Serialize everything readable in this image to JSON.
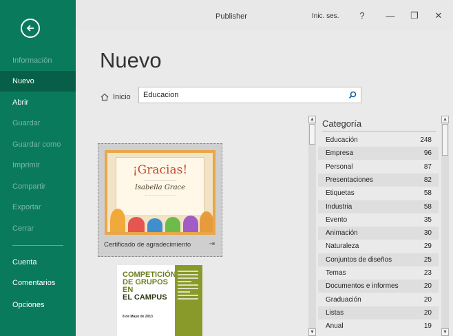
{
  "window": {
    "app_title": "Publisher",
    "signin_label": "Inic. ses.",
    "help_label": "?",
    "minimize_label": "—",
    "restore_label": "❐",
    "close_label": "✕"
  },
  "sidebar": {
    "accent_color": "#0a7a5d",
    "items": [
      {
        "label": "Información",
        "state": "disabled"
      },
      {
        "label": "Nuevo",
        "state": "active"
      },
      {
        "label": "Abrir",
        "state": "normal"
      },
      {
        "label": "Guardar",
        "state": "disabled"
      },
      {
        "label": "Guardar como",
        "state": "disabled"
      },
      {
        "label": "Imprimir",
        "state": "disabled"
      },
      {
        "label": "Compartir",
        "state": "disabled"
      },
      {
        "label": "Exportar",
        "state": "disabled"
      },
      {
        "label": "Cerrar",
        "state": "disabled"
      },
      {
        "label": "Cuenta",
        "state": "normal"
      },
      {
        "label": "Comentarios",
        "state": "normal"
      },
      {
        "label": "Opciones",
        "state": "normal"
      }
    ]
  },
  "main": {
    "page_title": "Nuevo",
    "home_label": "Inicio",
    "search_value": "Educacion",
    "templates": [
      {
        "label": "Certificado de agradecimiento",
        "preview_heading": "¡Gracias!",
        "preview_name": "Isabella Grace"
      },
      {
        "label": "",
        "preview_headline_1": "COMPETICIÓN",
        "preview_headline_2": "DE GRUPOS EN",
        "preview_headline_3": "EL CAMPUS",
        "preview_date": "8 de Mayo de 2013"
      }
    ]
  },
  "categories": {
    "header": "Categoría",
    "items": [
      {
        "name": "Educación",
        "count": "248"
      },
      {
        "name": "Empresa",
        "count": "96"
      },
      {
        "name": "Personal",
        "count": "87"
      },
      {
        "name": "Presentaciones",
        "count": "82"
      },
      {
        "name": "Etiquetas",
        "count": "58"
      },
      {
        "name": "Industria",
        "count": "58"
      },
      {
        "name": "Evento",
        "count": "35"
      },
      {
        "name": "Animación",
        "count": "30"
      },
      {
        "name": "Naturaleza",
        "count": "29"
      },
      {
        "name": "Conjuntos de diseños",
        "count": "25"
      },
      {
        "name": "Temas",
        "count": "23"
      },
      {
        "name": "Documentos e informes",
        "count": "20"
      },
      {
        "name": "Graduación",
        "count": "20"
      },
      {
        "name": "Listas",
        "count": "20"
      },
      {
        "name": "Anual",
        "count": "19"
      }
    ]
  }
}
